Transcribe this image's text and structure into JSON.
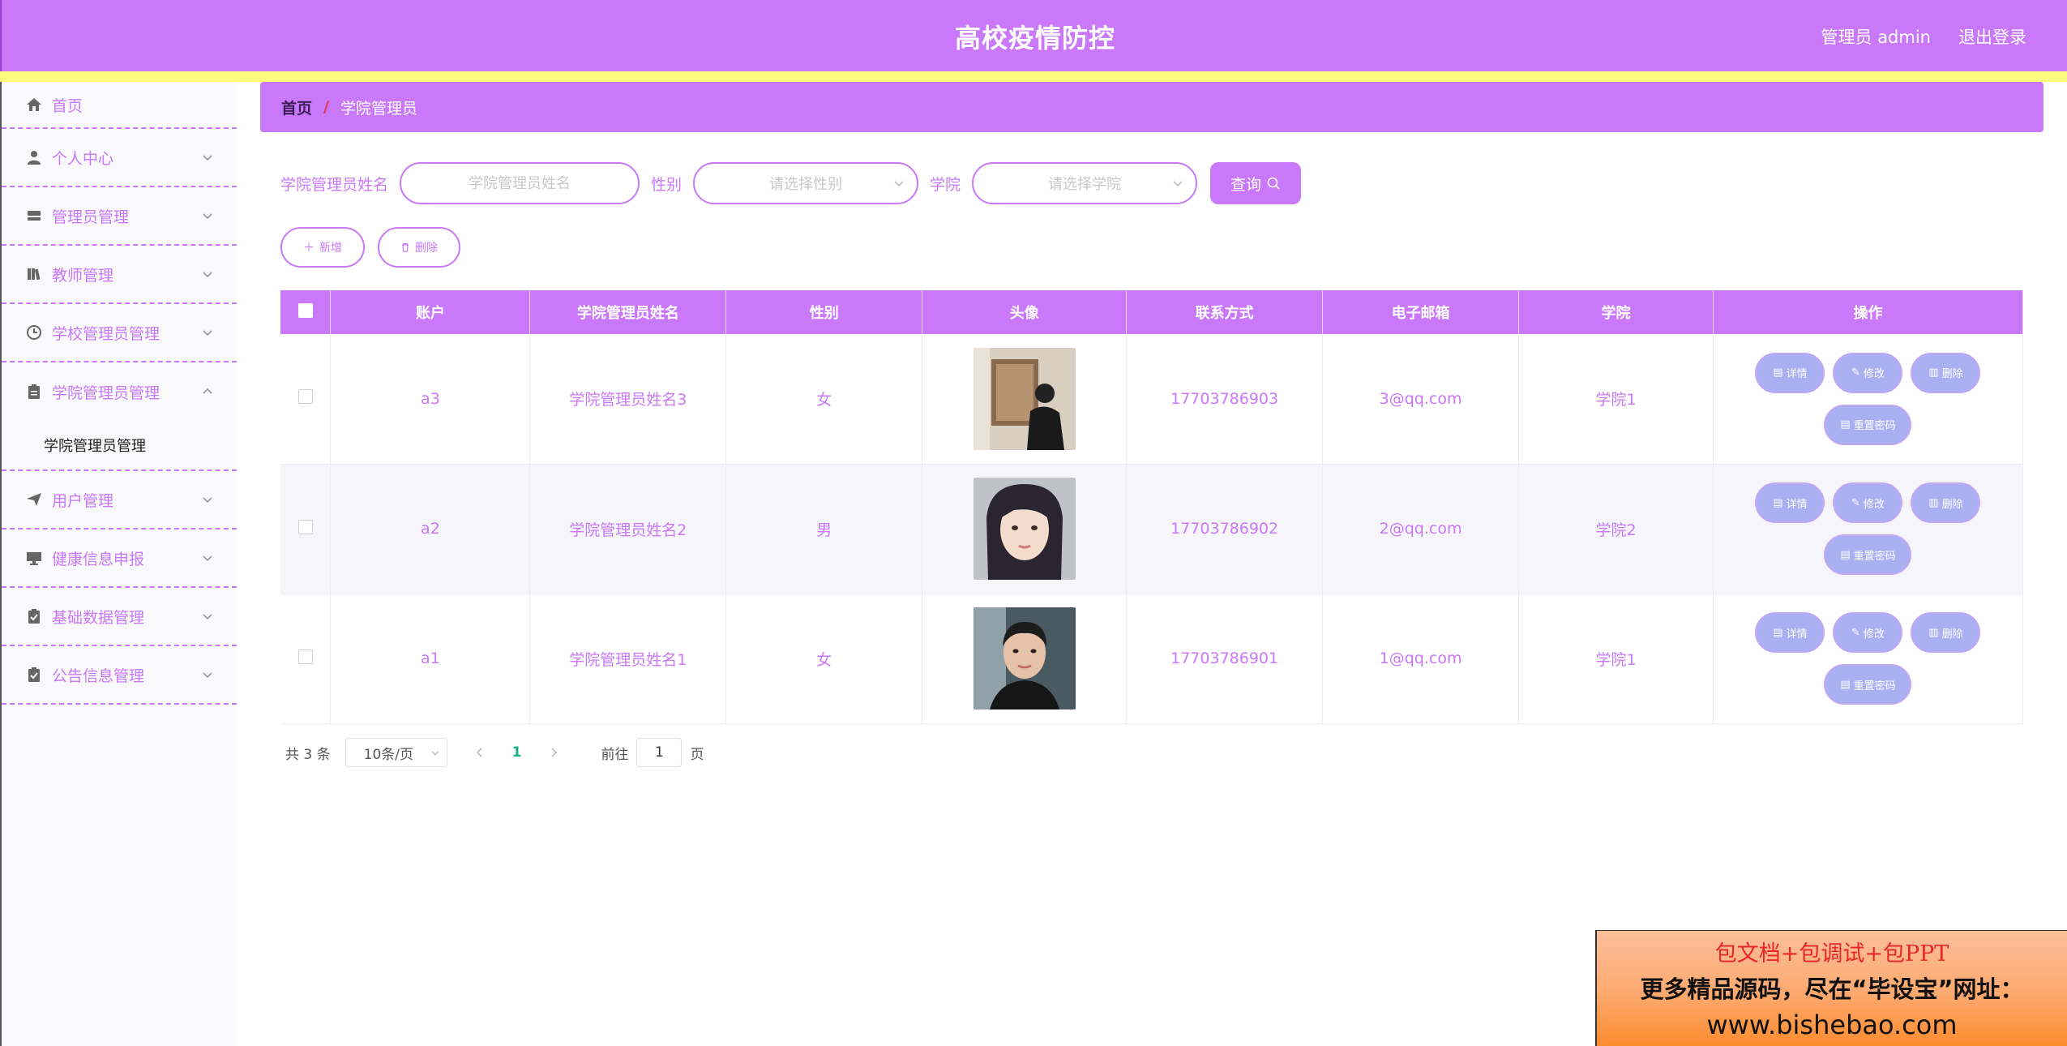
{
  "header": {
    "title": "高校疫情防控",
    "user": "管理员 admin",
    "logout": "退出登录"
  },
  "sidebar": {
    "items": [
      {
        "label": "首页",
        "icon": "home-icon"
      },
      {
        "label": "个人中心",
        "icon": "user-icon"
      },
      {
        "label": "管理员管理",
        "icon": "inbox-icon"
      },
      {
        "label": "教师管理",
        "icon": "book-icon"
      },
      {
        "label": "学校管理员管理",
        "icon": "clock-icon"
      },
      {
        "label": "学院管理员管理",
        "icon": "clipboard-icon"
      },
      {
        "label": "用户管理",
        "icon": "send-icon"
      },
      {
        "label": "健康信息申报",
        "icon": "monitor-icon"
      },
      {
        "label": "基础数据管理",
        "icon": "checklist-icon"
      },
      {
        "label": "公告信息管理",
        "icon": "checklist-icon"
      }
    ],
    "sub_item": "学院管理员管理"
  },
  "breadcrumb": {
    "home": "首页",
    "separator": "/",
    "current": "学院管理员"
  },
  "search": {
    "name_label": "学院管理员姓名",
    "name_placeholder": "学院管理员姓名",
    "gender_label": "性别",
    "gender_placeholder": "请选择性别",
    "college_label": "学院",
    "college_placeholder": "请选择学院",
    "query_label": "查询"
  },
  "actions": {
    "add_label": "新增",
    "delete_label": "删除"
  },
  "table": {
    "headers": [
      "账户",
      "学院管理员姓名",
      "性别",
      "头像",
      "联系方式",
      "电子邮箱",
      "学院",
      "操作"
    ],
    "rows": [
      {
        "account": "a3",
        "name": "学院管理员姓名3",
        "gender": "女",
        "phone": "17703786903",
        "email": "3@qq.com",
        "college": "学院1"
      },
      {
        "account": "a2",
        "name": "学院管理员姓名2",
        "gender": "男",
        "phone": "17703786902",
        "email": "2@qq.com",
        "college": "学院2"
      },
      {
        "account": "a1",
        "name": "学院管理员姓名1",
        "gender": "女",
        "phone": "17703786901",
        "email": "1@qq.com",
        "college": "学院1"
      }
    ],
    "op_labels": {
      "detail": "详情",
      "edit": "修改",
      "delete": "删除",
      "reset": "重置密码"
    }
  },
  "pagination": {
    "total": "共 3 条",
    "page_size": "10条/页",
    "current_page": "1",
    "goto_prefix": "前往",
    "goto_value": "1",
    "goto_suffix": "页"
  },
  "ad": {
    "line1": "包文档+包调试+包PPT",
    "line2": "更多精品源码，尽在“毕设宝”网址：",
    "line3": "www.bishebao.com"
  },
  "colors": {
    "primary": "#c978f9",
    "stripe": "#fbfb7d",
    "op_button": "#a9b0f2",
    "page_active": "#16b08a"
  }
}
